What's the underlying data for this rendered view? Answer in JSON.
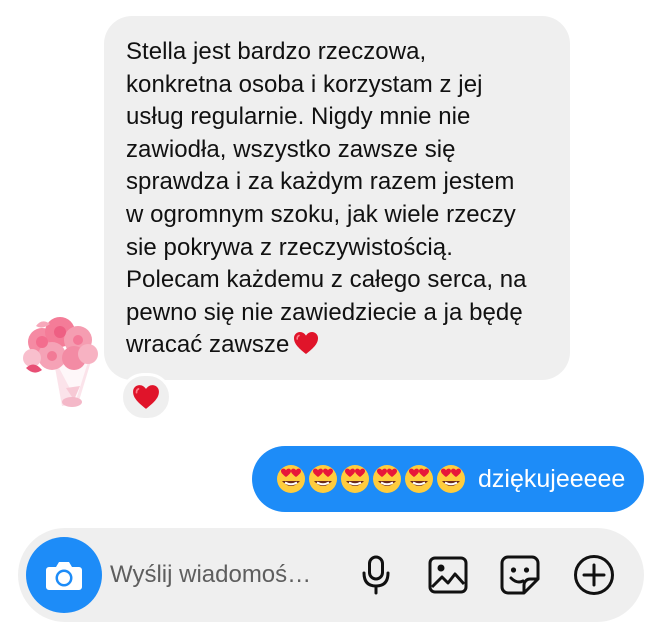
{
  "thread": {
    "incoming_message": {
      "lines": [
        "Stella jest bardzo rzeczowa,",
        "konkretna osoba i korzystam z jej",
        "usług regularnie. Nigdy mnie nie",
        "zawiodła, wszystko zawsze się",
        "sprawdza i za każdym razem jestem",
        "w ogromnym szoku, jak wiele rzeczy",
        "sie pokrywa z rzeczywistością.",
        "Polecam każdemu z całego serca, na",
        "pewno się nie zawiedziecie a ja będę",
        "wracać zawsze"
      ],
      "trailing_emoji": "red-heart",
      "reaction": "red-heart"
    },
    "outgoing_message": {
      "emojis": [
        "heart-eyes",
        "heart-eyes",
        "heart-eyes",
        "heart-eyes",
        "heart-eyes",
        "heart-eyes"
      ],
      "text": "dziękujeeeee"
    }
  },
  "composer": {
    "placeholder": "Wyślij wiadomoś…",
    "icons": [
      "camera-icon",
      "microphone-icon",
      "gallery-icon",
      "sticker-icon",
      "add-icon"
    ]
  },
  "colors": {
    "accent": "#1d8cf8",
    "incoming_bubble": "#efefef",
    "heart": "#e0142a"
  }
}
